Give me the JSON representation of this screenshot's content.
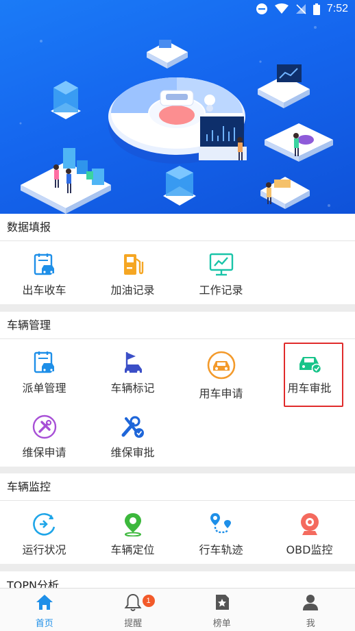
{
  "status_bar": {
    "time": "7:52"
  },
  "sections": {
    "data_entry": {
      "title": "数据填报",
      "items": [
        {
          "label": "出车收车",
          "icon": "clipboard-car-icon"
        },
        {
          "label": "加油记录",
          "icon": "fuel-pump-icon"
        },
        {
          "label": "工作记录",
          "icon": "monitor-chart-icon"
        }
      ]
    },
    "vehicle_management": {
      "title": "车辆管理",
      "items": [
        {
          "label": "派单管理",
          "icon": "dispatch-clipboard-icon"
        },
        {
          "label": "车辆标记",
          "icon": "flag-car-icon"
        },
        {
          "label": "用车申请",
          "icon": "car-circle-icon"
        },
        {
          "label": "用车审批",
          "icon": "car-check-icon"
        },
        {
          "label": "维保申请",
          "icon": "tools-circle-icon"
        },
        {
          "label": "维保审批",
          "icon": "wrench-check-icon"
        }
      ]
    },
    "vehicle_monitoring": {
      "title": "车辆监控",
      "items": [
        {
          "label": "运行状况",
          "icon": "running-status-icon"
        },
        {
          "label": "车辆定位",
          "icon": "location-pin-icon"
        },
        {
          "label": "行车轨迹",
          "icon": "route-track-icon"
        },
        {
          "label": "OBD监控",
          "icon": "obd-camera-icon"
        }
      ]
    },
    "partial_next": {
      "title": "TOPN分析"
    }
  },
  "bottom_nav": [
    {
      "label": "首页",
      "icon": "home-icon",
      "active": true
    },
    {
      "label": "提醒",
      "icon": "bell-icon",
      "badge": "1"
    },
    {
      "label": "榜单",
      "icon": "ranking-icon"
    },
    {
      "label": "我",
      "icon": "user-icon"
    }
  ],
  "colors": {
    "accent_blue": "#1e8fe8",
    "banner_blue": "#1566ee",
    "highlight_red": "#e02b2b",
    "badge_orange": "#f25a2a"
  }
}
